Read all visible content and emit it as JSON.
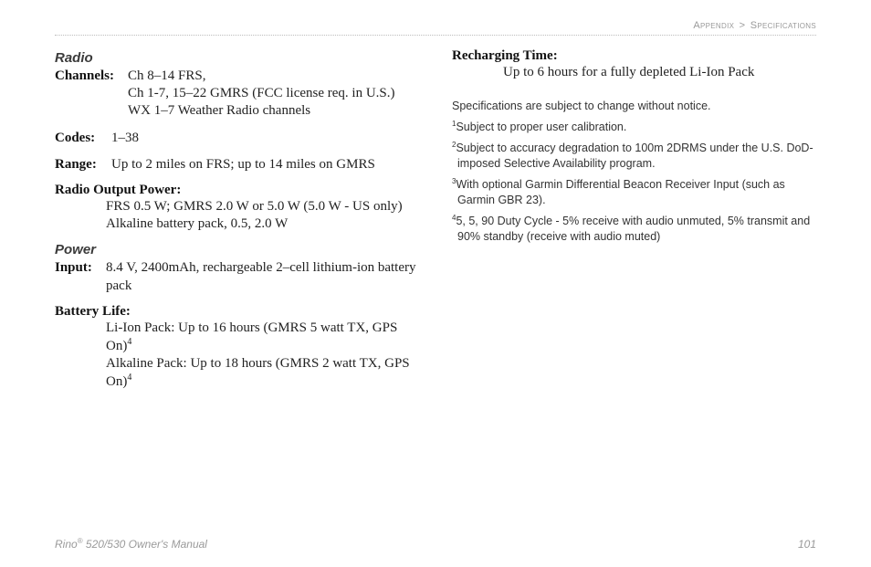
{
  "breadcrumb": {
    "part1": "Appendix",
    "sep": ">",
    "part2": "Specifications"
  },
  "left": {
    "radio": {
      "title": "Radio",
      "channels": {
        "label": "Channels:",
        "line1": "Ch 8–14 FRS,",
        "line2": "Ch 1-7, 15–22 GMRS (FCC license req. in U.S.)",
        "line3": "WX 1–7 Weather Radio channels"
      },
      "codes": {
        "label": "Codes:",
        "value": "1–38"
      },
      "range": {
        "label": "Range:",
        "value": "Up to 2 miles on FRS; up to 14 miles on GMRS"
      },
      "output": {
        "label": "Radio Output Power:",
        "line1": "FRS 0.5 W; GMRS 2.0 W or 5.0 W (5.0 W - US only)",
        "line2": "Alkaline battery pack, 0.5, 2.0 W"
      }
    },
    "power": {
      "title": "Power",
      "input": {
        "label": "Input:",
        "value": "8.4 V, 2400mAh, rechargeable 2–cell lithium-ion battery pack"
      },
      "battery": {
        "label": "Battery Life:",
        "line1a": "Li-Ion Pack: Up to 16 hours (GMRS 5 watt TX, GPS On)",
        "line1sup": "4",
        "line2a": "Alkaline Pack: Up to 18 hours (GMRS 2 watt TX, GPS On)",
        "line2sup": "4"
      }
    }
  },
  "right": {
    "recharge": {
      "label": "Recharging Time:",
      "value": "Up to 6 hours for a fully depleted Li-Ion Pack"
    },
    "intro": "Specifications are subject to change without notice.",
    "fn1": {
      "n": "1",
      "text": "Subject to proper user calibration."
    },
    "fn2": {
      "n": "2",
      "text": "Subject to accuracy degradation to 100m 2DRMS under the U.S. DoD-imposed Selective Availability program."
    },
    "fn3": {
      "n": "3",
      "text": "With optional Garmin Differential Beacon Receiver Input (such as Garmin GBR 23)."
    },
    "fn4": {
      "n": "4",
      "text": "5, 5, 90 Duty Cycle - 5% receive with audio unmuted, 5% transmit and 90% standby (receive with audio muted)"
    }
  },
  "footer": {
    "product_a": "Rino",
    "reg": "®",
    "product_b": " 520/530 Owner's Manual",
    "page": "101"
  }
}
